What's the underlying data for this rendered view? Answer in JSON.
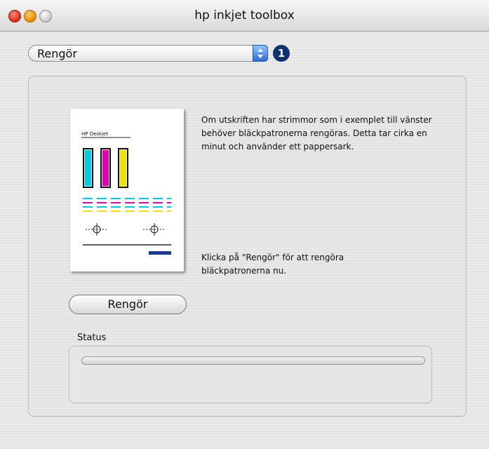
{
  "window": {
    "title": "hp inkjet toolbox"
  },
  "popup": {
    "selected": "Rengör",
    "icon": "stepper-arrows-icon"
  },
  "badge": {
    "number": "1"
  },
  "sample_page": {
    "header_text": "HP Deskjet"
  },
  "description": "Om utskriften har strimmor som i exemplet till vänster behöver bläckpatronerna rengöras. Detta tar cirka en minut och använder ett pappersark.",
  "hint": "Klicka på \"Rengör\" för att rengöra bläckpatronerna nu.",
  "clean_button": {
    "label": "Rengör"
  },
  "status": {
    "label": "Status",
    "progress": 0
  },
  "colors": {
    "cyan": "#00c8e8",
    "magenta": "#e000b0",
    "yellow": "#f0e000",
    "accent": "#2f6fd6"
  }
}
